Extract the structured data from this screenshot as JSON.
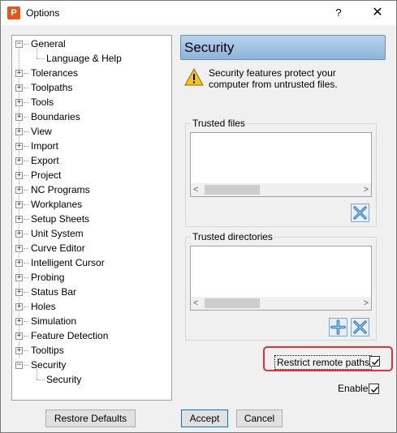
{
  "window": {
    "title": "Options",
    "help_glyph": "?",
    "close_glyph": "✕",
    "app_icon_letter": "P"
  },
  "tree": {
    "items": [
      {
        "label": "General",
        "expander": "−",
        "level": 0
      },
      {
        "label": "Language & Help",
        "expander": "",
        "level": 1
      },
      {
        "label": "Tolerances",
        "expander": "+",
        "level": 0
      },
      {
        "label": "Toolpaths",
        "expander": "+",
        "level": 0
      },
      {
        "label": "Tools",
        "expander": "+",
        "level": 0
      },
      {
        "label": "Boundaries",
        "expander": "+",
        "level": 0
      },
      {
        "label": "View",
        "expander": "+",
        "level": 0
      },
      {
        "label": "Import",
        "expander": "+",
        "level": 0
      },
      {
        "label": "Export",
        "expander": "+",
        "level": 0
      },
      {
        "label": "Project",
        "expander": "+",
        "level": 0
      },
      {
        "label": "NC Programs",
        "expander": "+",
        "level": 0
      },
      {
        "label": "Workplanes",
        "expander": "+",
        "level": 0
      },
      {
        "label": "Setup Sheets",
        "expander": "+",
        "level": 0
      },
      {
        "label": "Unit System",
        "expander": "+",
        "level": 0
      },
      {
        "label": "Curve Editor",
        "expander": "+",
        "level": 0
      },
      {
        "label": "Intelligent Cursor",
        "expander": "+",
        "level": 0
      },
      {
        "label": "Probing",
        "expander": "+",
        "level": 0
      },
      {
        "label": "Status Bar",
        "expander": "+",
        "level": 0
      },
      {
        "label": "Holes",
        "expander": "+",
        "level": 0
      },
      {
        "label": "Simulation",
        "expander": "+",
        "level": 0
      },
      {
        "label": "Feature Detection",
        "expander": "+",
        "level": 0
      },
      {
        "label": "Tooltips",
        "expander": "+",
        "level": 0
      },
      {
        "label": "Security",
        "expander": "−",
        "level": 0
      },
      {
        "label": "Security",
        "expander": "",
        "level": 1
      }
    ]
  },
  "panel": {
    "title": "Security",
    "warning_text": "Security features protect your computer from untrusted files.",
    "trusted_files": {
      "label": "Trusted files",
      "scroll_left": "<",
      "scroll_right": ">"
    },
    "trusted_directories": {
      "label": "Trusted directories",
      "scroll_left": "<",
      "scroll_right": ">"
    },
    "restrict_remote_paths": {
      "label": "Restrict remote paths",
      "checked": true
    },
    "enable": {
      "label": "Enable",
      "checked": true
    }
  },
  "buttons": {
    "restore_defaults": "Restore Defaults",
    "accept": "Accept",
    "cancel": "Cancel"
  },
  "icons": {
    "warning": "warning-icon",
    "remove": "remove-icon",
    "add": "add-icon",
    "checkmark": "checkmark-icon"
  },
  "colors": {
    "header_gradient_top": "#b8d3ee",
    "header_gradient_bottom": "#8fb3da",
    "highlight_border": "#e0303a",
    "app_icon": "#e8561f"
  }
}
